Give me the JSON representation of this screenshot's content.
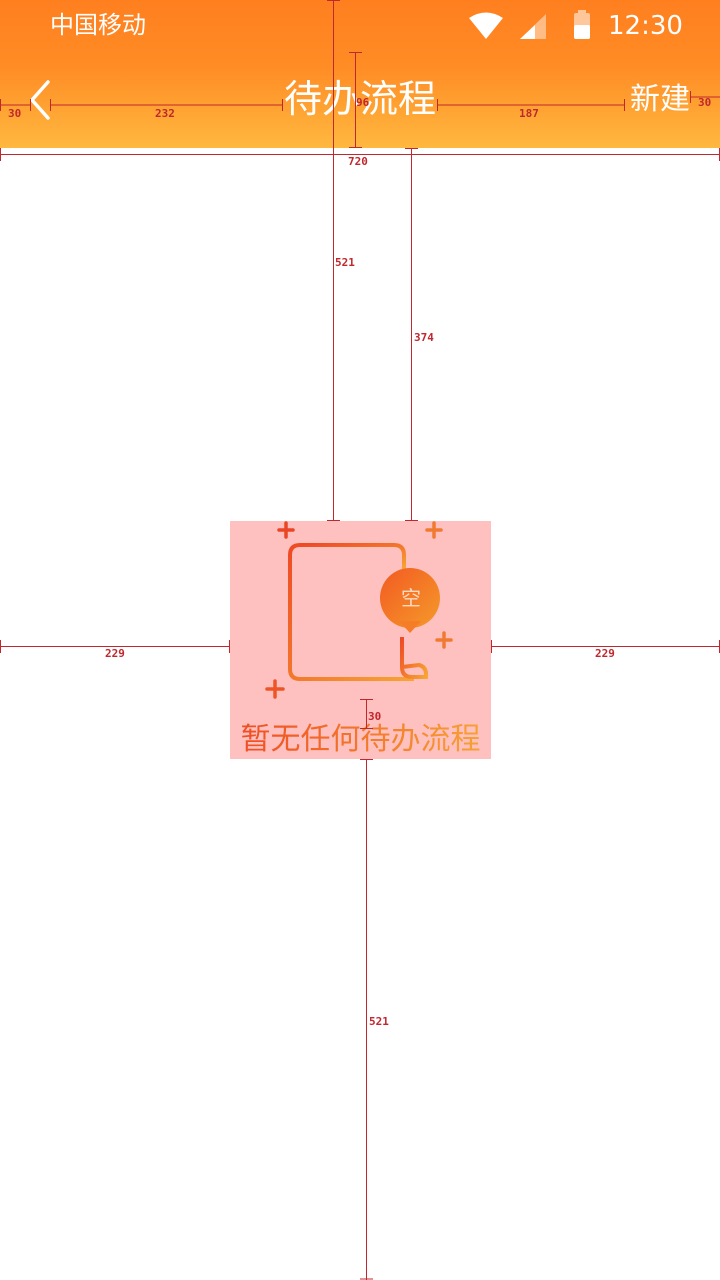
{
  "status_bar": {
    "carrier": "中国移动",
    "time": "12:30",
    "icons": [
      "wifi-icon",
      "signal-icon",
      "battery-icon"
    ]
  },
  "nav": {
    "back_icon": "chevron-left-icon",
    "title": "待办流程",
    "right_action": "新建"
  },
  "empty_state": {
    "icon": "empty-document-icon",
    "badge_char": "空",
    "message": "暂无任何待办流程"
  },
  "annotations": {
    "back_margin": "30",
    "back_to_title": "232",
    "bar_height": "96",
    "title_to_action": "187",
    "action_margin": "30",
    "screen_width": "720",
    "icon_top_from_status": "521",
    "icon_top_from_bar": "374",
    "icon_left": "229",
    "icon_right": "229",
    "icon_text_gap": "30",
    "text_bottom": "521"
  },
  "colors": {
    "header_gradient_top": "#ff7f1f",
    "header_gradient_bottom": "#ffb83f",
    "accent": "#f26522",
    "annotation": "#c0282d",
    "highlight_box": "#ffc0c0"
  }
}
